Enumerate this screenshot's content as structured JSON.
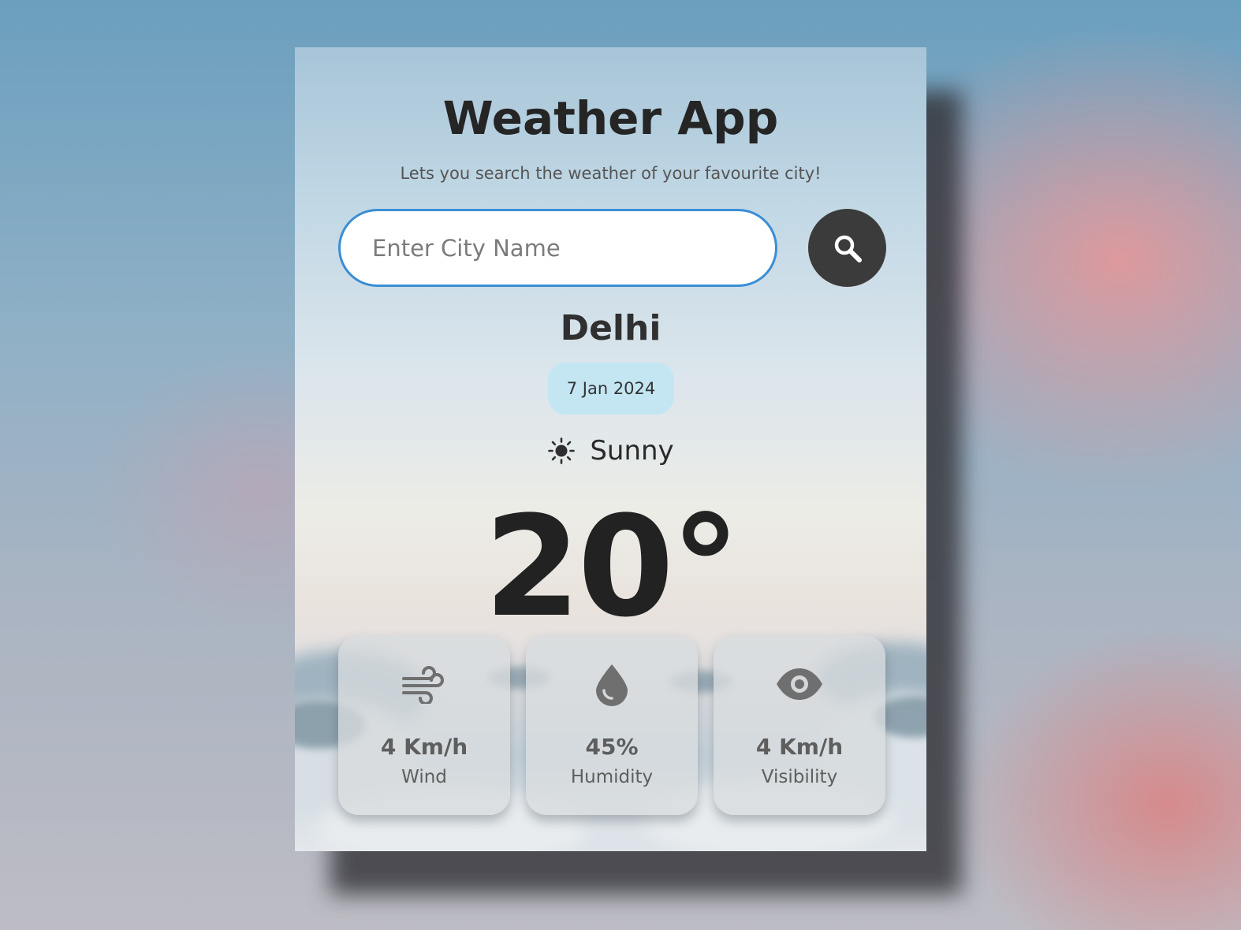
{
  "app": {
    "title": "Weather App",
    "subtitle": "Lets you search the weather of your favourite city!"
  },
  "search": {
    "placeholder": "Enter City Name",
    "value": "",
    "button_icon": "search-icon"
  },
  "weather": {
    "city": "Delhi",
    "date": "7 Jan 2024",
    "condition": "Sunny",
    "condition_icon": "sun-icon",
    "temperature": "20°"
  },
  "stats": [
    {
      "icon": "wind-icon",
      "value": "4 Km/h",
      "label": "Wind"
    },
    {
      "icon": "water-drop-icon",
      "value": "45%",
      "label": "Humidity"
    },
    {
      "icon": "eye-icon",
      "value": "4 Km/h",
      "label": "Visibility"
    }
  ],
  "colors": {
    "accent_border": "#3a8ed4",
    "search_button": "#3b3b3b",
    "date_pill": "#c3e6f2"
  }
}
